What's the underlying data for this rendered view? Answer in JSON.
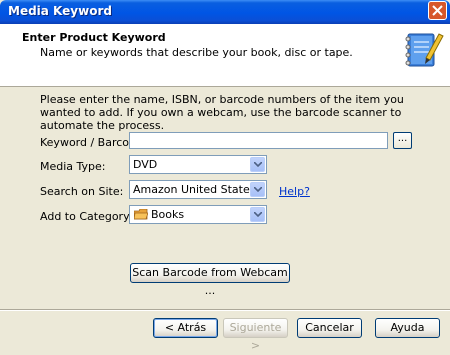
{
  "window": {
    "title": "Media Keyword"
  },
  "header": {
    "title": "Enter Product Keyword",
    "subtitle": "Name or keywords that describe your book, disc or tape."
  },
  "intro": "Please enter the name, ISBN, or barcode numbers of the item you wanted to add. If you own a webcam, use the barcode scanner to automate the process.",
  "form": {
    "keyword_label": "Keyword / Barcode:",
    "keyword_value": "",
    "browse_label": "...",
    "media_type_label": "Media Type:",
    "media_type_value": "DVD",
    "search_site_label": "Search on Site:",
    "search_site_value": "Amazon United States",
    "help_link": "Help?",
    "category_label": "Add to Category:",
    "category_value": "Books",
    "category_icon": "folder-icon"
  },
  "scan_button": "Scan Barcode from Webcam ...",
  "buttons": {
    "back": "< Atrás",
    "next": "Siguiente >",
    "cancel": "Cancelar",
    "help": "Ayuda"
  },
  "colors": {
    "titlebar": "#0055e5",
    "link": "#0033cc",
    "close": "#d7572a"
  }
}
